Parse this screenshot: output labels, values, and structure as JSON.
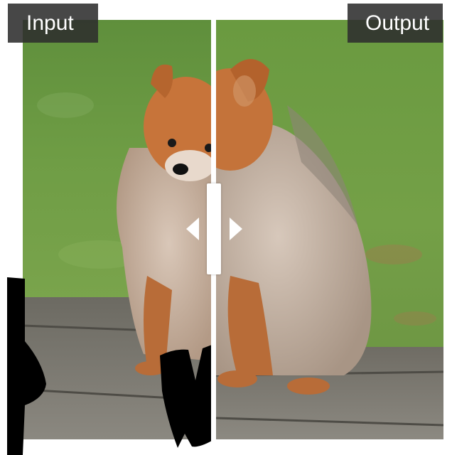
{
  "labels": {
    "input": "Input",
    "output": "Output"
  },
  "icons": {
    "handle_left": "triangle-left-icon",
    "handle_right": "triangle-right-icon"
  },
  "colors": {
    "label_background": "#2d2d2d",
    "label_text": "#ffffff",
    "divider": "#ffffff",
    "mask": "#000000"
  }
}
